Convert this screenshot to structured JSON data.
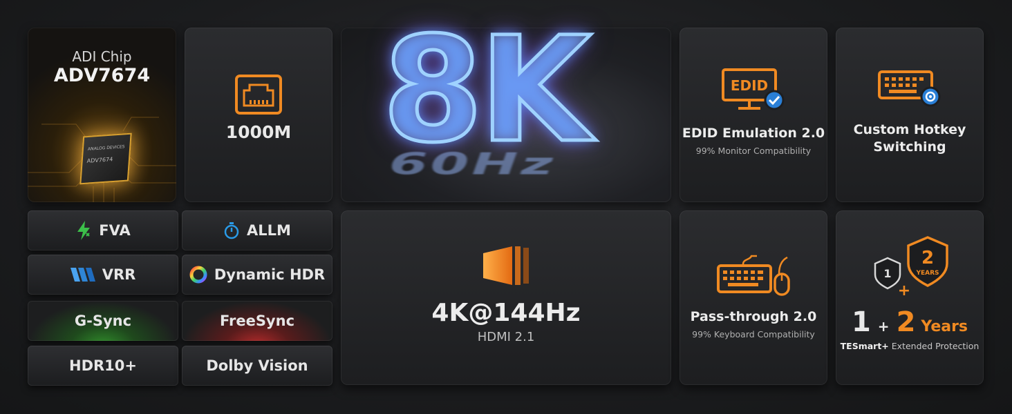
{
  "chip": {
    "title": "ADI Chip",
    "model": "ADV7674",
    "package_brand": "ANALOG DEVICES",
    "package_model": "ADV7674"
  },
  "lan": {
    "label": "1000M",
    "icon": "ethernet-port-icon"
  },
  "hero": {
    "main": "8K",
    "sub": "60Hz"
  },
  "edid": {
    "badge": "EDID",
    "title": "EDID Emulation 2.0",
    "subtitle": "99% Monitor Compatibility",
    "icon": "monitor-check-icon"
  },
  "hotkey": {
    "title_line1": "Custom Hotkey",
    "title_line2": "Switching",
    "icon": "keyboard-gear-icon"
  },
  "features": {
    "fva": "FVA",
    "allm": "ALLM",
    "vrr": "VRR",
    "dynamic_hdr": "Dynamic HDR",
    "gsync": "G-Sync",
    "freesync": "FreeSync",
    "hdr10": "HDR10+",
    "dolby": "Dolby Vision"
  },
  "hdmi": {
    "resolution": "4K@144Hz",
    "version": "HDMI 2.1",
    "icon": "speed-bars-icon"
  },
  "passthrough": {
    "title": "Pass-through 2.0",
    "subtitle": "99% Keyboard Compatibility",
    "icon": "keyboard-mouse-icon"
  },
  "warranty": {
    "shield_small": "1",
    "shield_big_num": "2",
    "shield_big_label": "YEARS",
    "plus_sign": "+",
    "num1": "1",
    "plus": "+",
    "num2": "2",
    "years": "Years",
    "brand": "TESmart+",
    "protection": "Extended Protection"
  },
  "colors": {
    "accent_orange": "#f08a22",
    "gsync_green": "#2f8a2a",
    "freesync_red": "#b02a2a"
  }
}
